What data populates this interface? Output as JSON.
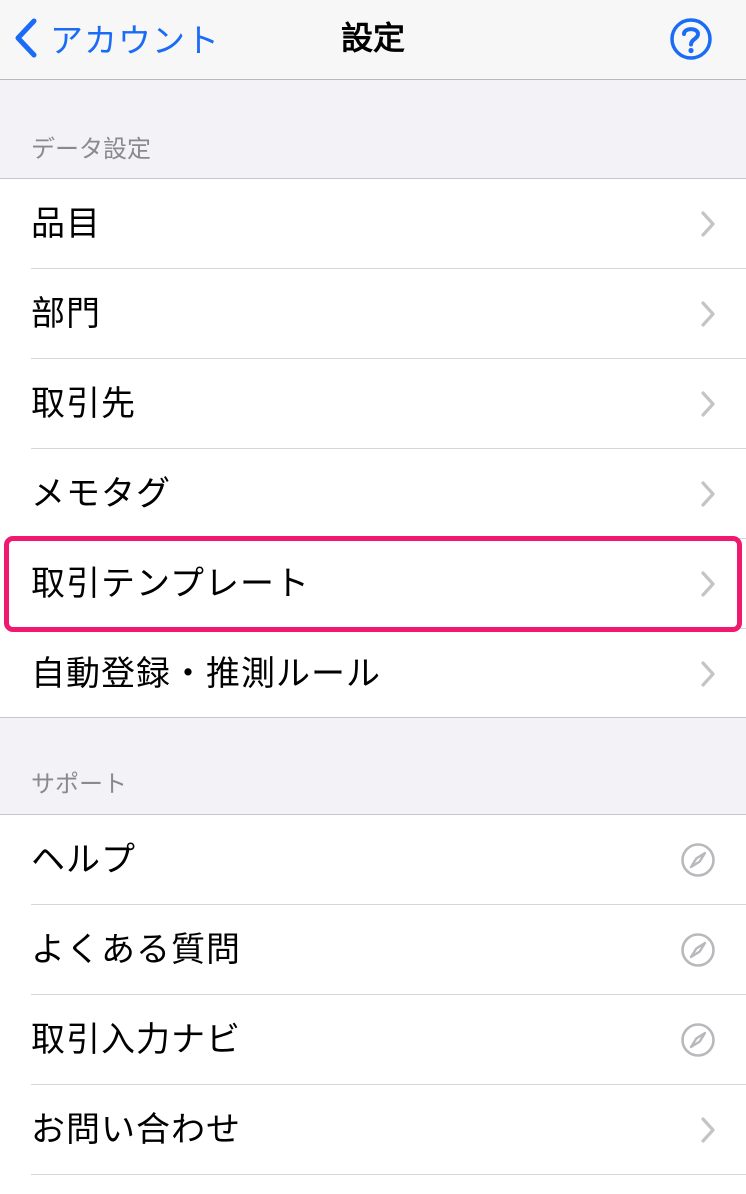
{
  "navbar": {
    "back_label": "アカウント",
    "title": "設定",
    "help_icon": "question-circle-icon",
    "accent_color": "#1a6bf5"
  },
  "sections": [
    {
      "header": "データ設定",
      "items": [
        {
          "label": "品目",
          "accessory": "chevron-right-icon"
        },
        {
          "label": "部門",
          "accessory": "chevron-right-icon"
        },
        {
          "label": "取引先",
          "accessory": "chevron-right-icon"
        },
        {
          "label": "メモタグ",
          "accessory": "chevron-right-icon"
        },
        {
          "label": "取引テンプレート",
          "accessory": "chevron-right-icon",
          "highlighted": true
        },
        {
          "label": "自動登録・推測ルール",
          "accessory": "chevron-right-icon"
        }
      ]
    },
    {
      "header": "サポート",
      "items": [
        {
          "label": "ヘルプ",
          "accessory": "compass-icon"
        },
        {
          "label": "よくある質問",
          "accessory": "compass-icon"
        },
        {
          "label": "取引入力ナビ",
          "accessory": "compass-icon"
        },
        {
          "label": "お問い合わせ",
          "accessory": "chevron-right-icon"
        }
      ]
    }
  ],
  "highlight_color": "#f0186f"
}
